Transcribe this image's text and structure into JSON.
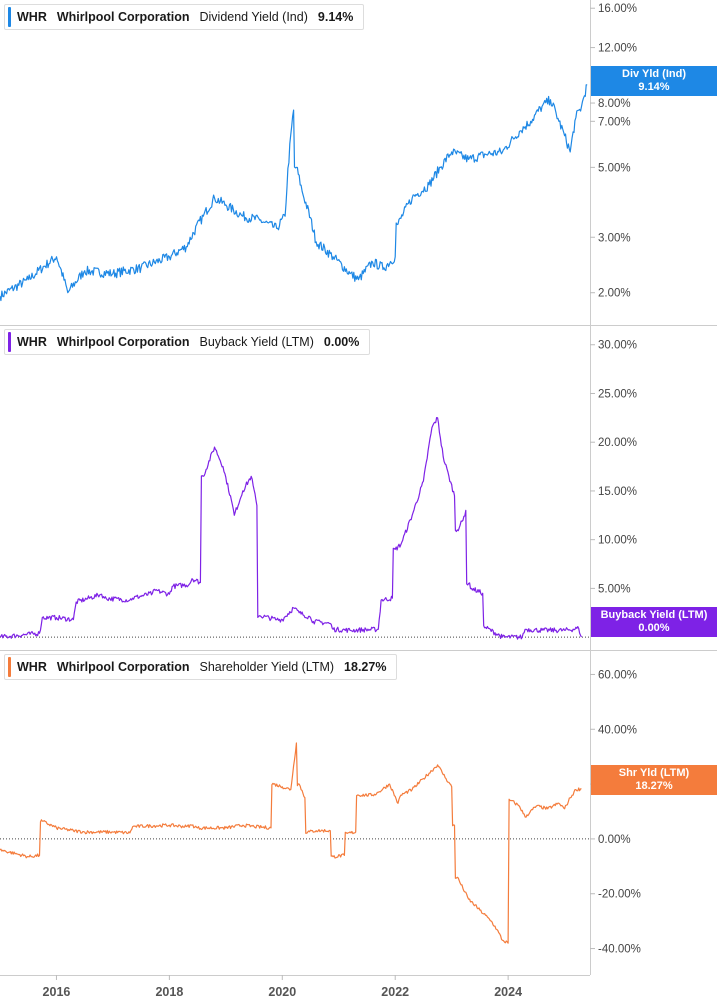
{
  "chart_data": [
    {
      "type": "line",
      "ticker": "WHR",
      "company": "Whirlpool Corporation",
      "metric": "Dividend Yield (Ind)",
      "value": "9.14%",
      "tag": {
        "line1": "Div Yld (Ind)",
        "line2": "9.14%"
      },
      "color": "#1e88e5",
      "scale": "log",
      "ylim": [
        1.75,
        16.5
      ],
      "yticks": [
        "2.00%",
        "3.00%",
        "5.00%",
        "7.00%",
        "8.00%",
        "12.00%",
        "16.00%"
      ],
      "ytick_values": [
        2,
        3,
        5,
        7,
        8,
        12,
        16
      ],
      "x": [
        2015.0,
        2015.5,
        2016.0,
        2016.2,
        2016.5,
        2017.0,
        2017.5,
        2018.0,
        2018.3,
        2018.6,
        2018.8,
        2019.0,
        2019.3,
        2019.6,
        2019.9,
        2020.05,
        2020.2,
        2020.25,
        2020.35,
        2020.6,
        2020.9,
        2021.2,
        2021.35,
        2021.6,
        2021.8,
        2022.0,
        2022.05,
        2022.3,
        2022.6,
        2022.8,
        2023.0,
        2023.3,
        2023.6,
        2023.9,
        2024.2,
        2024.4,
        2024.6,
        2024.75,
        2024.9,
        2025.0,
        2025.1,
        2025.2,
        2025.3,
        2025.4
      ],
      "y": [
        1.95,
        2.2,
        2.6,
        2.0,
        2.35,
        2.3,
        2.4,
        2.6,
        2.8,
        3.5,
        4.0,
        3.8,
        3.5,
        3.4,
        3.2,
        3.5,
        7.6,
        5.0,
        4.2,
        2.9,
        2.6,
        2.3,
        2.2,
        2.5,
        2.4,
        2.6,
        3.3,
        4.0,
        4.4,
        5.0,
        5.6,
        5.3,
        5.5,
        5.6,
        6.5,
        7.0,
        7.8,
        8.2,
        7.0,
        6.3,
        5.6,
        7.2,
        7.8,
        9.14
      ]
    },
    {
      "type": "line",
      "ticker": "WHR",
      "company": "Whirlpool Corporation",
      "metric": "Buyback Yield (LTM)",
      "value": "0.00%",
      "tag": {
        "line1": "Buyback Yield (LTM)",
        "line2": "0.00%"
      },
      "color": "#7e22e6",
      "scale": "linear",
      "ylim": [
        -0.5,
        31
      ],
      "yticks": [
        "5.00%",
        "10.00%",
        "15.00%",
        "20.00%",
        "25.00%",
        "30.00%"
      ],
      "ytick_values": [
        5,
        10,
        15,
        20,
        25,
        30
      ],
      "x": [
        2015.0,
        2015.7,
        2015.75,
        2016.0,
        2016.3,
        2016.35,
        2016.8,
        2016.85,
        2017.3,
        2017.35,
        2017.7,
        2017.75,
        2018.0,
        2018.05,
        2018.35,
        2018.4,
        2018.55,
        2018.6,
        2018.8,
        2018.95,
        2019.1,
        2019.15,
        2019.3,
        2019.45,
        2019.55,
        2019.6,
        2019.9,
        2020.0,
        2020.2,
        2020.3,
        2020.5,
        2020.55,
        2020.85,
        2020.9,
        2021.2,
        2021.7,
        2021.75,
        2021.95,
        2022.0,
        2022.1,
        2022.3,
        2022.5,
        2022.65,
        2022.75,
        2022.85,
        2022.95,
        2023.05,
        2023.1,
        2023.2,
        2023.25,
        2023.3,
        2023.35,
        2023.55,
        2023.6,
        2023.9,
        2024.25,
        2024.3,
        2024.6,
        2025.0,
        2025.25,
        2025.3
      ],
      "y": [
        0.0,
        0.4,
        2.0,
        2.0,
        1.8,
        3.6,
        4.4,
        4.0,
        3.8,
        4.0,
        4.5,
        4.8,
        4.4,
        5.2,
        5.4,
        6.0,
        5.6,
        16.5,
        19.5,
        17.5,
        14.0,
        12.5,
        15.0,
        16.5,
        13.5,
        2.2,
        1.8,
        1.8,
        3.0,
        2.5,
        2.0,
        1.6,
        1.4,
        0.8,
        0.7,
        0.8,
        3.8,
        4.0,
        9.0,
        9.5,
        12.5,
        16.0,
        21.5,
        22.5,
        18.5,
        16.5,
        14.5,
        11.0,
        12.0,
        13.0,
        5.5,
        5.0,
        4.5,
        1.0,
        0.0,
        0.0,
        0.8,
        0.7,
        0.7,
        0.9,
        0.0
      ]
    },
    {
      "type": "line",
      "ticker": "WHR",
      "company": "Whirlpool Corporation",
      "metric": "Shareholder Yield (LTM)",
      "value": "18.27%",
      "tag": {
        "line1": "Shr Yld (LTM)",
        "line2": "18.27%"
      },
      "color": "#f47c3c",
      "scale": "linear",
      "ylim": [
        -46,
        66
      ],
      "yticks": [
        "-40.00%",
        "-20.00%",
        "0.00%",
        "20.00%",
        "40.00%",
        "60.00%"
      ],
      "ytick_values": [
        -40,
        -20,
        0,
        20,
        40,
        60
      ],
      "x": [
        2015.0,
        2015.3,
        2015.5,
        2015.7,
        2015.75,
        2016.0,
        2016.3,
        2016.5,
        2017.0,
        2017.3,
        2017.35,
        2018.0,
        2018.3,
        2018.4,
        2018.5,
        2019.0,
        2019.3,
        2019.5,
        2019.8,
        2019.85,
        2020.0,
        2020.15,
        2020.25,
        2020.3,
        2020.4,
        2020.45,
        2020.6,
        2020.85,
        2020.9,
        2021.1,
        2021.15,
        2021.3,
        2021.35,
        2021.6,
        2021.7,
        2021.9,
        2022.05,
        2022.1,
        2022.3,
        2022.5,
        2022.75,
        2022.9,
        2023.0,
        2023.05,
        2023.1,
        2023.3,
        2023.5,
        2023.7,
        2023.8,
        2023.9,
        2024.0,
        2024.05,
        2024.2,
        2024.3,
        2024.5,
        2024.7,
        2024.9,
        2025.0,
        2025.1,
        2025.2,
        2025.3
      ],
      "y": [
        -4.0,
        -5.5,
        -6.5,
        -6.0,
        6.5,
        4.0,
        3.0,
        2.5,
        2.5,
        2.2,
        4.5,
        5.0,
        4.5,
        5.0,
        4.0,
        4.0,
        5.0,
        4.5,
        4.0,
        20.0,
        19.0,
        18.0,
        35.0,
        20.0,
        15.0,
        2.5,
        3.0,
        3.0,
        -6.5,
        -6.0,
        2.0,
        2.5,
        16.0,
        16.0,
        17.0,
        20.0,
        13.0,
        16.0,
        18.0,
        22.0,
        27.0,
        22.0,
        19.0,
        5.0,
        -14.0,
        -22.0,
        -26.0,
        -30.0,
        -33.0,
        -37.0,
        -38.0,
        14.0,
        12.0,
        8.0,
        12.0,
        11.0,
        13.0,
        11.0,
        15.0,
        18.0,
        18.27
      ]
    }
  ],
  "x_axis": {
    "labels": [
      "2016",
      "2018",
      "2020",
      "2022",
      "2024"
    ],
    "values": [
      2016,
      2018,
      2020,
      2022,
      2024
    ],
    "xlim": [
      2015.0,
      2025.45
    ]
  }
}
